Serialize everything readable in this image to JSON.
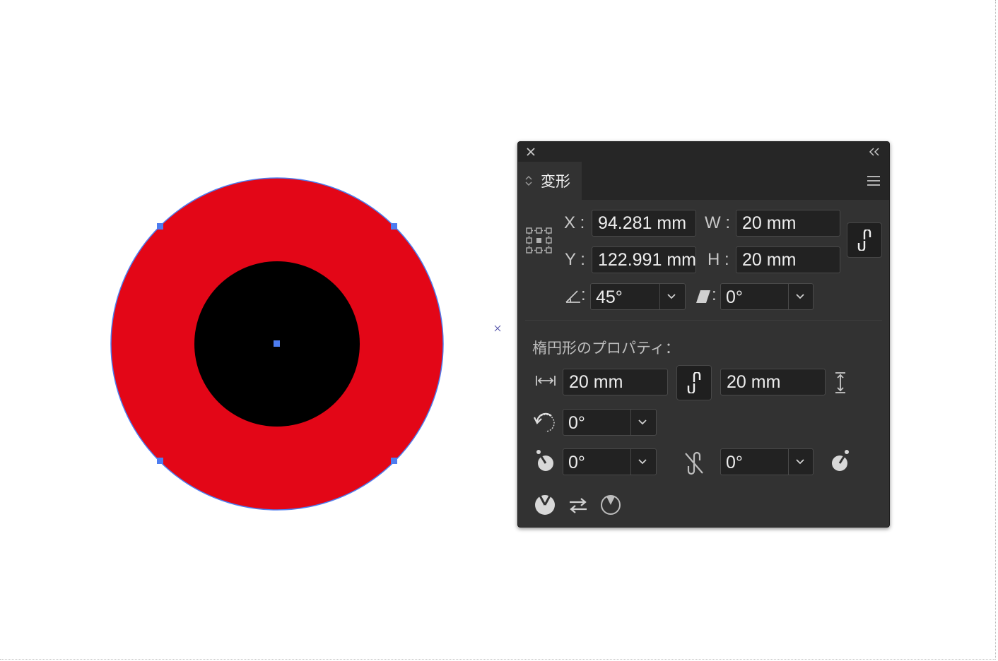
{
  "colors": {
    "outer_fill": "#e30617",
    "inner_fill": "#000000",
    "selection": "#4d7cf0",
    "panel_bg": "#323232"
  },
  "canvas": {
    "shapes": [
      "outer-red-circle",
      "inner-black-circle"
    ],
    "icons": [
      "anchor-point",
      "center-marker"
    ]
  },
  "panel": {
    "icons": [
      "close-icon",
      "collapse-icon",
      "panel-menu-icon"
    ],
    "tab": {
      "label": "変形",
      "icon": "up-down-arrows-icon"
    },
    "transform": {
      "reference_point_icon": "reference-point-grid-icon",
      "x_label": "X :",
      "x_value": "94.281 mm",
      "y_label": "Y :",
      "y_value": "122.991 mm",
      "w_label": "W :",
      "w_value": "20 mm",
      "h_label": "H :",
      "h_value": "20 mm",
      "constrain_icon": "link-icon",
      "rotate_label": ":",
      "rotate_icon": "angle-icon",
      "rotate_value": "45°",
      "shear_label": ":",
      "shear_icon": "shear-icon",
      "shear_value": "0°"
    },
    "ellipse": {
      "title": "楕円形のプロパティ：",
      "width_icon": "horizontal-width-icon",
      "width_value": "20 mm",
      "constrain_icon": "link-icon",
      "height_value": "20 mm",
      "height_icon": "vertical-height-icon",
      "rotation_icon": "rotate-ccw-icon",
      "rotation_value": "0°",
      "pie_start_icon": "pie-start-angle-icon",
      "pie_start_value": "0°",
      "pie_constrain_icon": "unlink-icon",
      "pie_end_value": "0°",
      "pie_end_icon": "pie-end-angle-icon",
      "bottom_icons": [
        "pie-icon",
        "swap-arrows-icon",
        "pie-outline-icon"
      ]
    }
  }
}
